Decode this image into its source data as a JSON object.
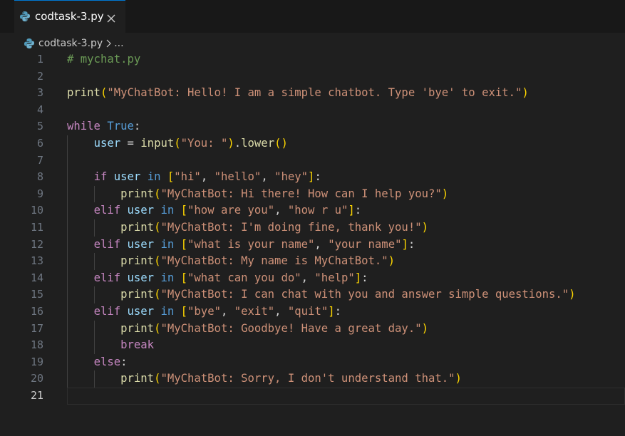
{
  "tab": {
    "label": "codtask-3.py",
    "icon": "python-icon",
    "close_icon": "close-icon"
  },
  "breadcrumb": {
    "file": "codtask-3.py",
    "more": "..."
  },
  "editor": {
    "active_line": 21,
    "lines": [
      {
        "n": "1",
        "tokens": [
          [
            "c-comment",
            "# mychat.py"
          ]
        ]
      },
      {
        "n": "2",
        "tokens": []
      },
      {
        "n": "3",
        "tokens": [
          [
            "c-fn",
            "print"
          ],
          [
            "c-p1",
            "("
          ],
          [
            "c-str",
            "\"MyChatBot: Hello! I am a simple chatbot. Type 'bye' to exit.\""
          ],
          [
            "c-p1",
            ")"
          ]
        ]
      },
      {
        "n": "4",
        "tokens": []
      },
      {
        "n": "5",
        "tokens": [
          [
            "c-kw",
            "while"
          ],
          [
            "c-op",
            " "
          ],
          [
            "c-const",
            "True"
          ],
          [
            "c-op",
            ":"
          ]
        ]
      },
      {
        "n": "6",
        "tokens": [
          [
            "c-op",
            "    "
          ],
          [
            "c-var",
            "user"
          ],
          [
            "c-op",
            " = "
          ],
          [
            "c-fn",
            "input"
          ],
          [
            "c-p1",
            "("
          ],
          [
            "c-str",
            "\"You: \""
          ],
          [
            "c-p1",
            ")"
          ],
          [
            "c-op",
            "."
          ],
          [
            "c-fn",
            "lower"
          ],
          [
            "c-p1",
            "()"
          ]
        ]
      },
      {
        "n": "7",
        "tokens": []
      },
      {
        "n": "8",
        "tokens": [
          [
            "c-op",
            "    "
          ],
          [
            "c-kw",
            "if"
          ],
          [
            "c-op",
            " "
          ],
          [
            "c-var",
            "user"
          ],
          [
            "c-op",
            " "
          ],
          [
            "c-const",
            "in"
          ],
          [
            "c-op",
            " "
          ],
          [
            "c-p1",
            "["
          ],
          [
            "c-str",
            "\"hi\""
          ],
          [
            "c-op",
            ", "
          ],
          [
            "c-str",
            "\"hello\""
          ],
          [
            "c-op",
            ", "
          ],
          [
            "c-str",
            "\"hey\""
          ],
          [
            "c-p1",
            "]"
          ],
          [
            "c-op",
            ":"
          ]
        ]
      },
      {
        "n": "9",
        "tokens": [
          [
            "c-op",
            "        "
          ],
          [
            "c-fn",
            "print"
          ],
          [
            "c-p1",
            "("
          ],
          [
            "c-str",
            "\"MyChatBot: Hi there! How can I help you?\""
          ],
          [
            "c-p1",
            ")"
          ]
        ]
      },
      {
        "n": "10",
        "tokens": [
          [
            "c-op",
            "    "
          ],
          [
            "c-kw",
            "elif"
          ],
          [
            "c-op",
            " "
          ],
          [
            "c-var",
            "user"
          ],
          [
            "c-op",
            " "
          ],
          [
            "c-const",
            "in"
          ],
          [
            "c-op",
            " "
          ],
          [
            "c-p1",
            "["
          ],
          [
            "c-str",
            "\"how are you\""
          ],
          [
            "c-op",
            ", "
          ],
          [
            "c-str",
            "\"how r u\""
          ],
          [
            "c-p1",
            "]"
          ],
          [
            "c-op",
            ":"
          ]
        ]
      },
      {
        "n": "11",
        "tokens": [
          [
            "c-op",
            "        "
          ],
          [
            "c-fn",
            "print"
          ],
          [
            "c-p1",
            "("
          ],
          [
            "c-str",
            "\"MyChatBot: I'm doing fine, thank you!\""
          ],
          [
            "c-p1",
            ")"
          ]
        ]
      },
      {
        "n": "12",
        "tokens": [
          [
            "c-op",
            "    "
          ],
          [
            "c-kw",
            "elif"
          ],
          [
            "c-op",
            " "
          ],
          [
            "c-var",
            "user"
          ],
          [
            "c-op",
            " "
          ],
          [
            "c-const",
            "in"
          ],
          [
            "c-op",
            " "
          ],
          [
            "c-p1",
            "["
          ],
          [
            "c-str",
            "\"what is your name\""
          ],
          [
            "c-op",
            ", "
          ],
          [
            "c-str",
            "\"your name\""
          ],
          [
            "c-p1",
            "]"
          ],
          [
            "c-op",
            ":"
          ]
        ]
      },
      {
        "n": "13",
        "tokens": [
          [
            "c-op",
            "        "
          ],
          [
            "c-fn",
            "print"
          ],
          [
            "c-p1",
            "("
          ],
          [
            "c-str",
            "\"MyChatBot: My name is MyChatBot.\""
          ],
          [
            "c-p1",
            ")"
          ]
        ]
      },
      {
        "n": "14",
        "tokens": [
          [
            "c-op",
            "    "
          ],
          [
            "c-kw",
            "elif"
          ],
          [
            "c-op",
            " "
          ],
          [
            "c-var",
            "user"
          ],
          [
            "c-op",
            " "
          ],
          [
            "c-const",
            "in"
          ],
          [
            "c-op",
            " "
          ],
          [
            "c-p1",
            "["
          ],
          [
            "c-str",
            "\"what can you do\""
          ],
          [
            "c-op",
            ", "
          ],
          [
            "c-str",
            "\"help\""
          ],
          [
            "c-p1",
            "]"
          ],
          [
            "c-op",
            ":"
          ]
        ]
      },
      {
        "n": "15",
        "tokens": [
          [
            "c-op",
            "        "
          ],
          [
            "c-fn",
            "print"
          ],
          [
            "c-p1",
            "("
          ],
          [
            "c-str",
            "\"MyChatBot: I can chat with you and answer simple questions.\""
          ],
          [
            "c-p1",
            ")"
          ]
        ]
      },
      {
        "n": "16",
        "tokens": [
          [
            "c-op",
            "    "
          ],
          [
            "c-kw",
            "elif"
          ],
          [
            "c-op",
            " "
          ],
          [
            "c-var",
            "user"
          ],
          [
            "c-op",
            " "
          ],
          [
            "c-const",
            "in"
          ],
          [
            "c-op",
            " "
          ],
          [
            "c-p1",
            "["
          ],
          [
            "c-str",
            "\"bye\""
          ],
          [
            "c-op",
            ", "
          ],
          [
            "c-str",
            "\"exit\""
          ],
          [
            "c-op",
            ", "
          ],
          [
            "c-str",
            "\"quit\""
          ],
          [
            "c-p1",
            "]"
          ],
          [
            "c-op",
            ":"
          ]
        ]
      },
      {
        "n": "17",
        "tokens": [
          [
            "c-op",
            "        "
          ],
          [
            "c-fn",
            "print"
          ],
          [
            "c-p1",
            "("
          ],
          [
            "c-str",
            "\"MyChatBot: Goodbye! Have a great day.\""
          ],
          [
            "c-p1",
            ")"
          ]
        ]
      },
      {
        "n": "18",
        "tokens": [
          [
            "c-op",
            "        "
          ],
          [
            "c-kw",
            "break"
          ]
        ]
      },
      {
        "n": "19",
        "tokens": [
          [
            "c-op",
            "    "
          ],
          [
            "c-kw",
            "else"
          ],
          [
            "c-op",
            ":"
          ]
        ]
      },
      {
        "n": "20",
        "tokens": [
          [
            "c-op",
            "        "
          ],
          [
            "c-fn",
            "print"
          ],
          [
            "c-p1",
            "("
          ],
          [
            "c-str",
            "\"MyChatBot: Sorry, I don't understand that.\""
          ],
          [
            "c-p1",
            ")"
          ]
        ]
      },
      {
        "n": "21",
        "tokens": []
      }
    ]
  },
  "colors": {
    "background": "#1f1f1f",
    "tab_accent": "#0078d4",
    "comment": "#6a9955",
    "function": "#dcdcaa",
    "string": "#ce9178",
    "keyword": "#c586c0",
    "constant": "#569cd6",
    "variable": "#9cdcfe"
  }
}
